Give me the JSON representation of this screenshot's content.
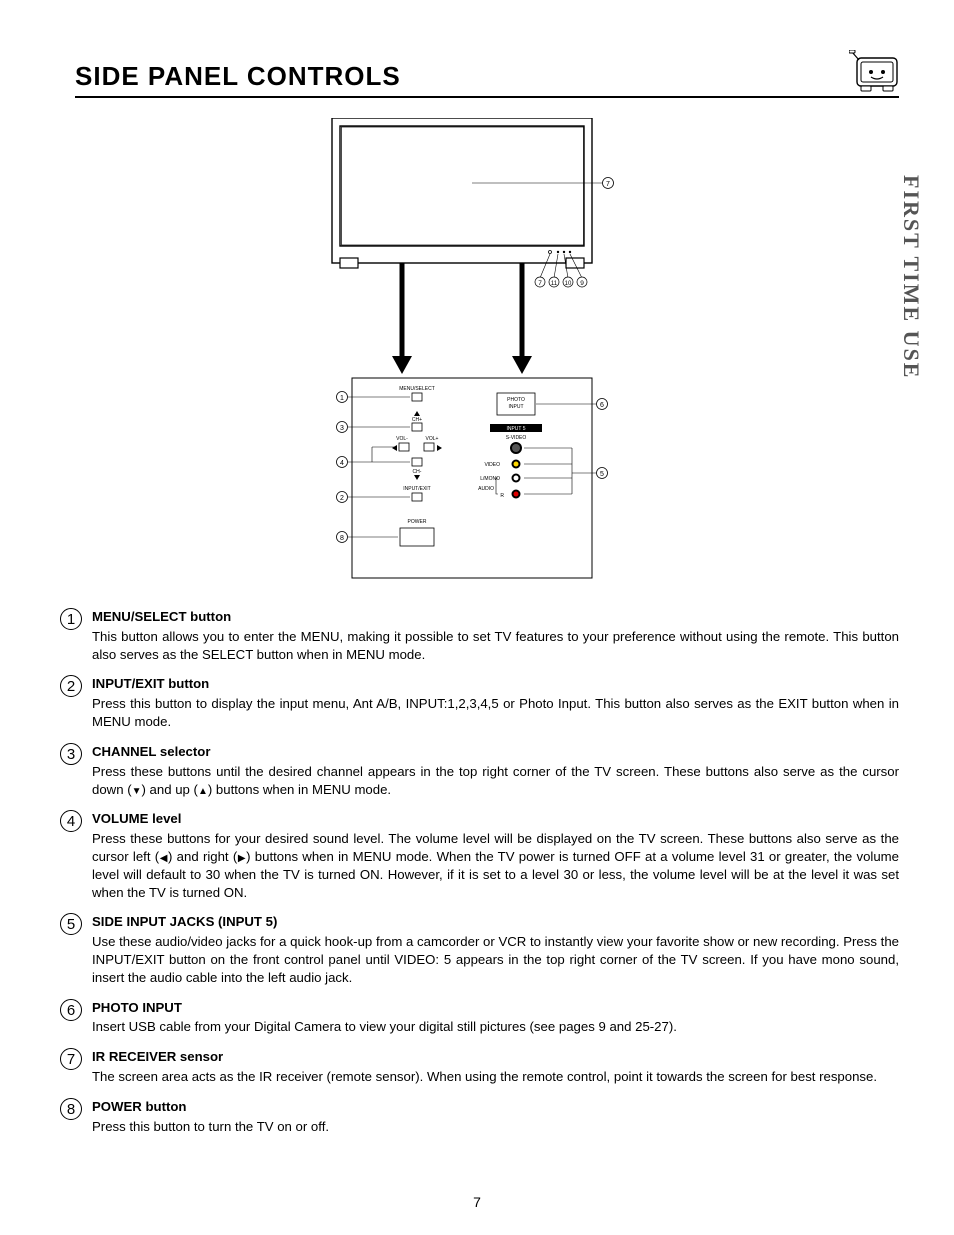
{
  "page": {
    "title": "SIDE PANEL CONTROLS",
    "side_tab": "FIRST TIME USE",
    "page_number": "7"
  },
  "diagram": {
    "labels": {
      "menu_select": "MENU/SELECT",
      "ch_up": "CH+",
      "vol_minus": "VOL-",
      "vol_plus": "VOL+",
      "ch_down": "CH-",
      "input_exit": "INPUT/EXIT",
      "power": "POWER",
      "photo_input": "PHOTO\nINPUT",
      "input5": "INPUT 5",
      "svideo": "S-VIDEO",
      "video": "VIDEO",
      "lmono": "L/MONO",
      "audio": "AUDIO",
      "r": "R"
    },
    "callouts": [
      "1",
      "2",
      "3",
      "4",
      "5",
      "6",
      "7",
      "8",
      "9",
      "10",
      "11"
    ]
  },
  "items": [
    {
      "num": "1",
      "title": "MENU/SELECT button",
      "desc": "This button allows you to enter the MENU, making it possible to set TV features to your preference without using the remote.  This button also serves as the SELECT button when in MENU mode."
    },
    {
      "num": "2",
      "title": "INPUT/EXIT button",
      "desc": "Press this button to display the input menu, Ant A/B, INPUT:1,2,3,4,5 or Photo Input.  This button also serves as the EXIT button when in MENU mode."
    },
    {
      "num": "3",
      "title": "CHANNEL selector",
      "desc_html": "Press these buttons until the desired channel appears in the top right corner of the TV screen.  These buttons also serve as the cursor down (<span class='glyph'>▼</span>) and up (<span class='glyph'>▲</span>) buttons when in MENU mode."
    },
    {
      "num": "4",
      "title": "VOLUME level",
      "desc_html": "Press these buttons for your desired sound level.  The volume level will be displayed on the TV screen.  These buttons also serve as the cursor left (<span class='glyph'>◀</span>) and right (<span class='glyph'>▶</span>) buttons when in MENU mode.  When the TV power is turned OFF at a volume level 31 or greater, the volume level will default to 30 when the TV is turned ON.  However, if it is set to a level 30 or less, the volume level will be at the level it was set when the TV is turned ON."
    },
    {
      "num": "5",
      "title": "SIDE INPUT JACKS (INPUT 5)",
      "desc": "Use these audio/video jacks for a quick hook-up from a camcorder or VCR to instantly view your favorite show or new recording.  Press the INPUT/EXIT button on the front control panel until VIDEO: 5 appears in the top right corner of the TV screen.  If you have mono sound, insert the audio cable into the left audio jack."
    },
    {
      "num": "6",
      "title": "PHOTO INPUT",
      "desc": "Insert USB cable from your Digital Camera to view your digital still pictures (see pages 9 and 25-27)."
    },
    {
      "num": "7",
      "title": "IR RECEIVER sensor",
      "desc": "The screen area acts as the IR receiver (remote sensor).  When using the remote control, point it towards the screen for best response."
    },
    {
      "num": "8",
      "title": "POWER button",
      "desc": "Press this button to turn the TV on or off."
    }
  ]
}
